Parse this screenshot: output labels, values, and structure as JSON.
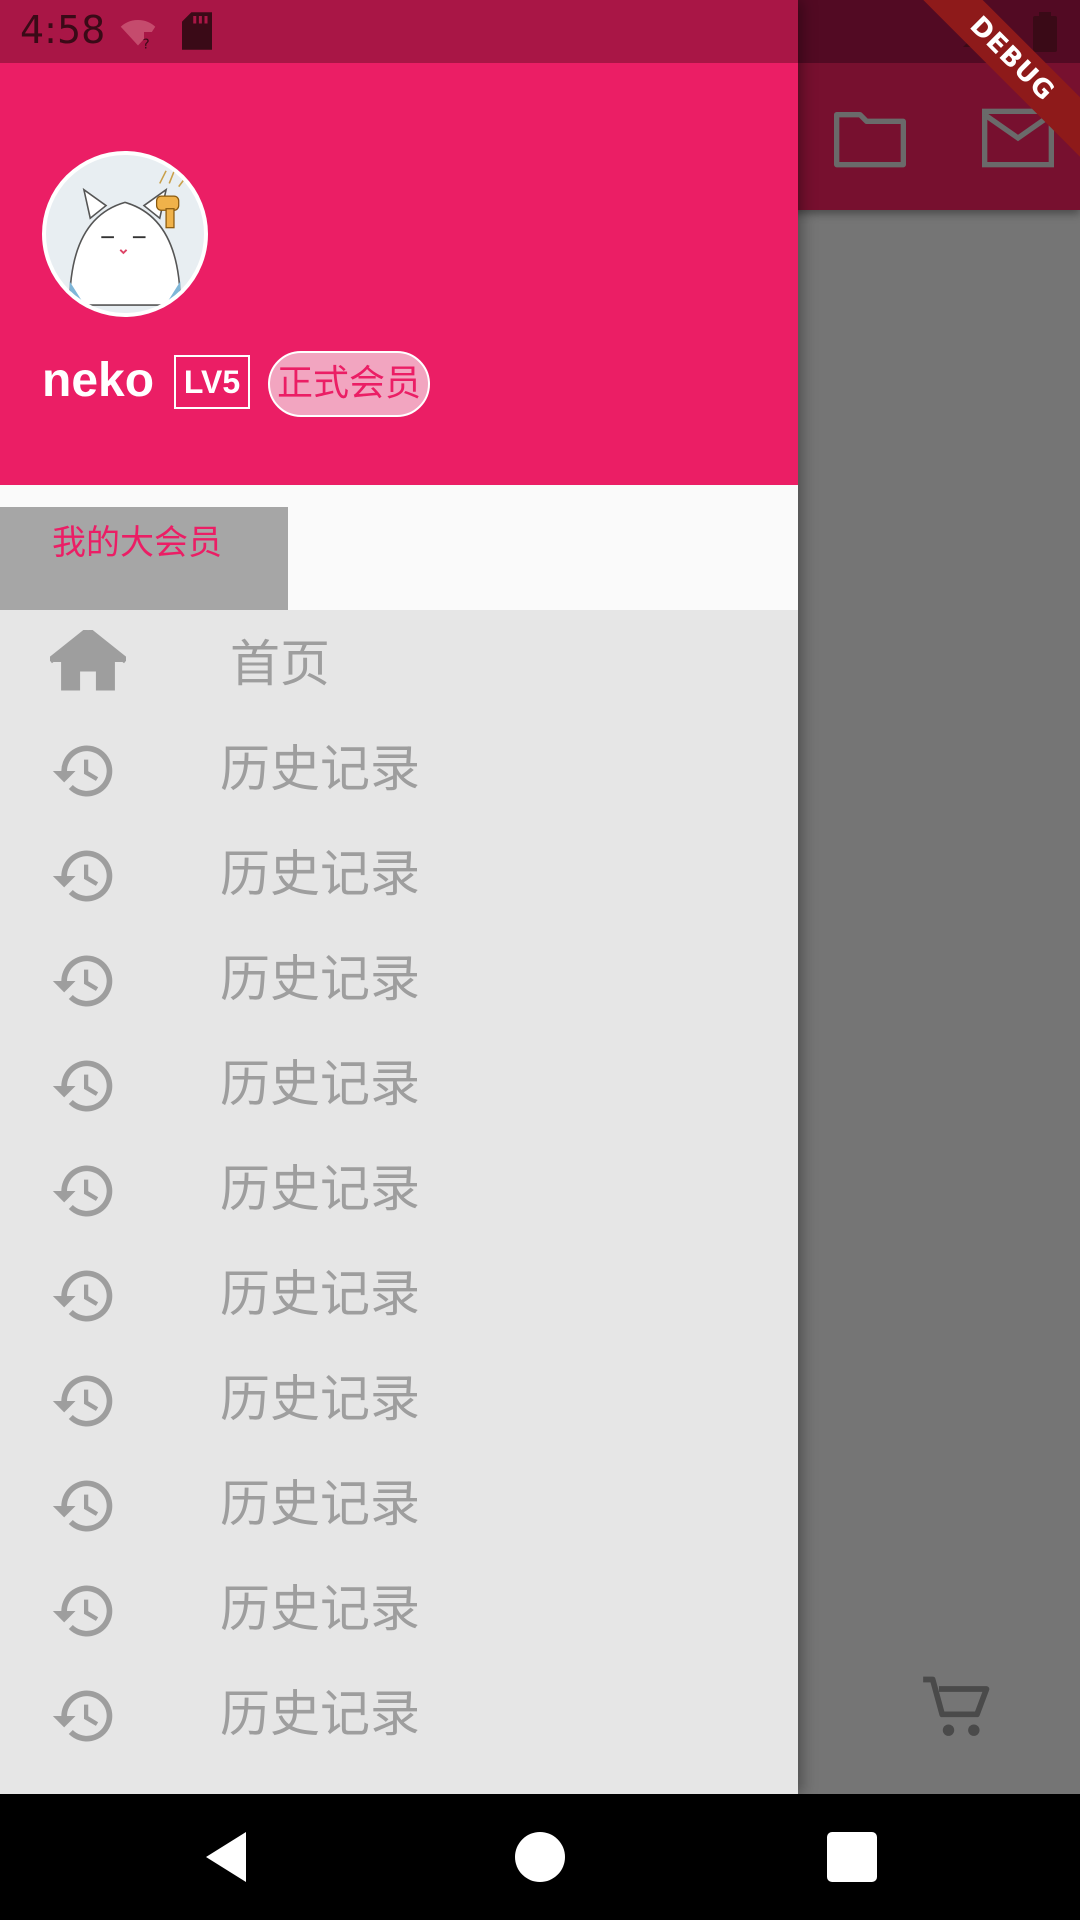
{
  "status_bar": {
    "time": "4:58",
    "icons": [
      "wifi-unknown-icon",
      "sd-card-icon",
      "signal-icon",
      "battery-icon"
    ]
  },
  "debug_banner": {
    "label": "DEBUG"
  },
  "app_bar": {
    "actions": [
      "folder-icon",
      "mail-icon"
    ]
  },
  "background": {
    "fab_icon": "cart-icon"
  },
  "drawer": {
    "header": {
      "avatar": "cat-avatar",
      "user_name": "neko",
      "level": "LV5",
      "membership": "正式会员"
    },
    "vip_button": {
      "label": "我的大会员"
    },
    "menu_items": [
      {
        "label": "首页",
        "icon": "home-icon"
      },
      {
        "label": "历史记录",
        "icon": "history-icon"
      },
      {
        "label": "历史记录",
        "icon": "history-icon"
      },
      {
        "label": "历史记录",
        "icon": "history-icon"
      },
      {
        "label": "历史记录",
        "icon": "history-icon"
      },
      {
        "label": "历史记录",
        "icon": "history-icon"
      },
      {
        "label": "历史记录",
        "icon": "history-icon"
      },
      {
        "label": "历史记录",
        "icon": "history-icon"
      },
      {
        "label": "历史记录",
        "icon": "history-icon"
      },
      {
        "label": "历史记录",
        "icon": "history-icon"
      },
      {
        "label": "历史记录",
        "icon": "history-icon"
      }
    ]
  },
  "colors": {
    "primary": "#eb1e65",
    "status_bar": "#a91646",
    "drawer_bg": "#e6e6e6",
    "menu_text": "#9e9e9e"
  },
  "nav_bar": {
    "buttons": [
      "back-icon",
      "home-circle-icon",
      "recents-icon"
    ]
  }
}
